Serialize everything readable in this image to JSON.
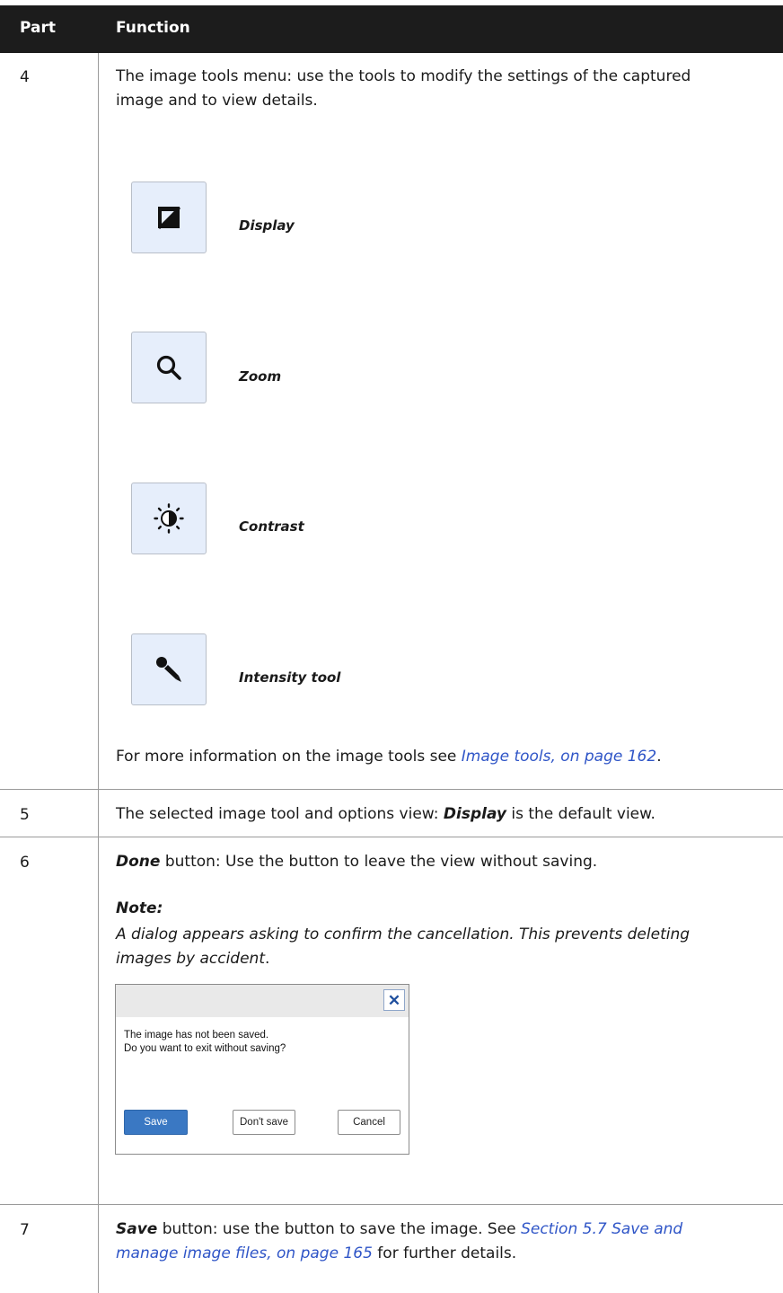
{
  "header": {
    "part": "Part",
    "function": "Function"
  },
  "rows": {
    "r4": {
      "part": "4",
      "intro_line1": "The image tools menu: use the tools to modify the settings of the captured",
      "intro_line2": "image and to view details.",
      "tools": [
        {
          "label": "Display",
          "icon": "display-icon"
        },
        {
          "label": "Zoom",
          "icon": "zoom-icon"
        },
        {
          "label": "Contrast",
          "icon": "contrast-icon"
        },
        {
          "label": "Intensity tool",
          "icon": "eyedropper-icon"
        }
      ],
      "more_pre": "For more information on the image tools see ",
      "more_link": "Image tools, on page 162",
      "more_post": "."
    },
    "r5": {
      "part": "5",
      "pre": "The selected image tool and options view: ",
      "bold": "Display",
      "post": " is the default view."
    },
    "r6": {
      "part": "6",
      "bold": "Done",
      "post": " button: Use the button to leave the view without saving.",
      "note_title": "Note:",
      "note_line1": "A dialog appears asking to confirm the cancellation. This prevents deleting",
      "note_line2": "images by accident",
      "note_end": ".",
      "dialog": {
        "close_glyph": "✕",
        "message_line1": "The image has not been saved.",
        "message_line2": "Do you want to exit without saving?",
        "save_label": "Save",
        "dont_save_label": "Don't save",
        "cancel_label": "Cancel"
      }
    },
    "r7": {
      "part": "7",
      "bold": "Save",
      "mid": " button: use the button to save the image. See ",
      "link1": "Section 5.7 Save and",
      "link2": "manage image files, on page 165",
      "post": " for further details."
    }
  },
  "colors": {
    "header_bg": "#1c1c1c",
    "link": "#2f55c7",
    "tool_bg": "#e6eefb",
    "dialog_save": "#3a78c3"
  }
}
